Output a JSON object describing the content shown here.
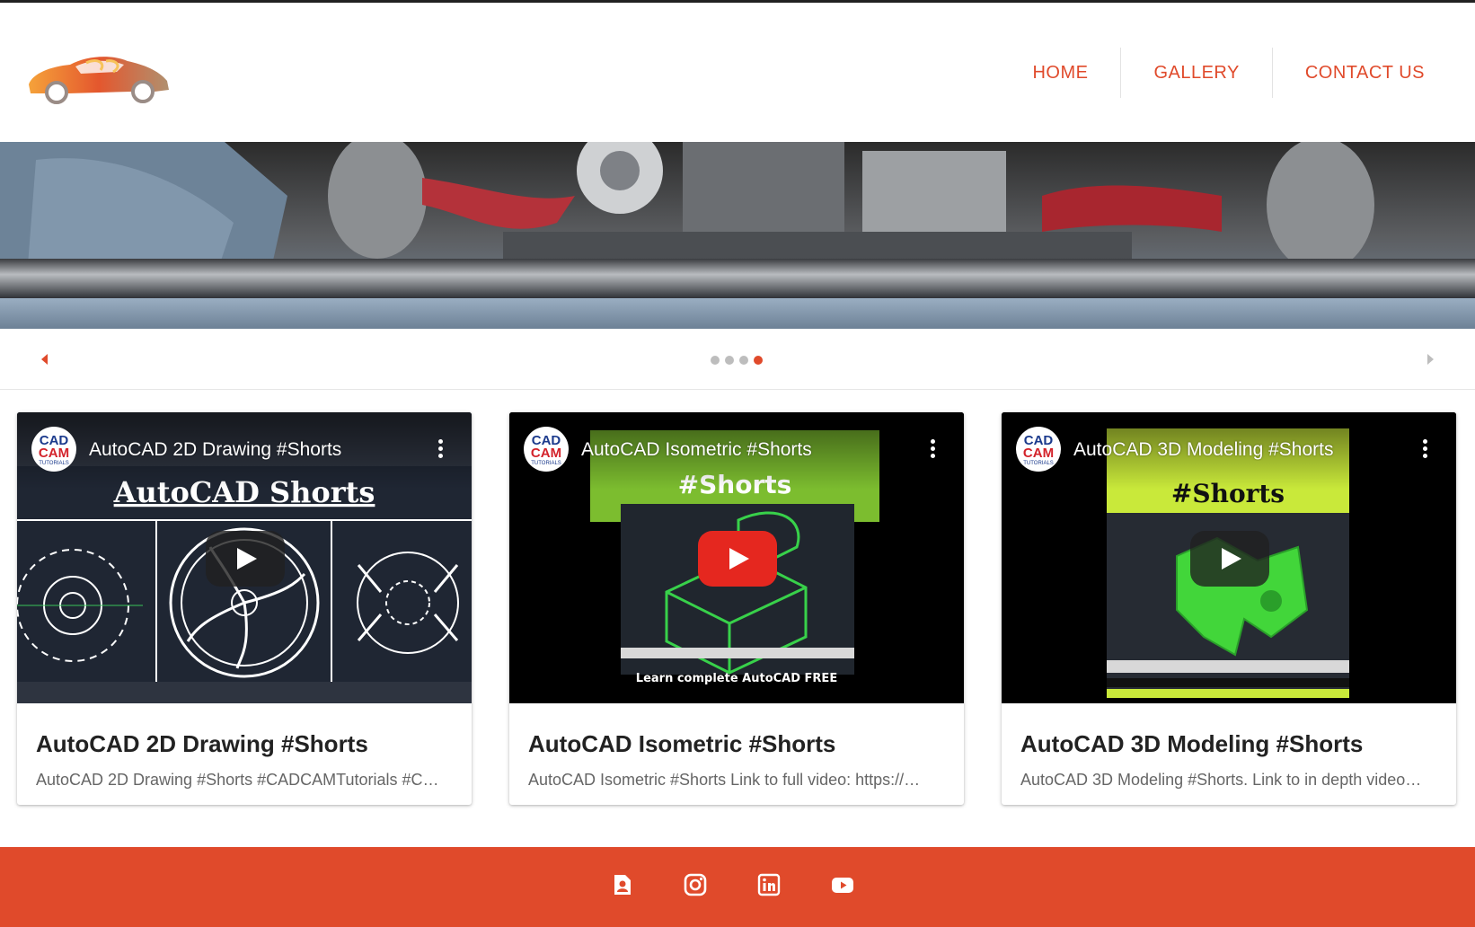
{
  "page": {
    "colors": {
      "accent": "#e04a2b",
      "footer": "#e04a2b",
      "dot_inactive": "#bdbdbd",
      "card_text": "#222222",
      "card_desc": "#666666"
    }
  },
  "header": {
    "logo": {
      "icon": "car-logo-icon"
    },
    "nav": [
      {
        "label": "HOME"
      },
      {
        "label": "GALLERY"
      },
      {
        "label": "CONTACT US"
      }
    ]
  },
  "carousel": {
    "prev_icon": "caret-left-icon",
    "next_icon": "caret-right-icon",
    "slide_count": 4,
    "active_index": 3
  },
  "videos": [
    {
      "embed_title": "AutoCAD 2D Drawing #Shorts",
      "thumbnail_text": "AutoCAD Shorts",
      "channel_avatar_text": [
        "CAD",
        "CAM",
        "TUTORIALS"
      ],
      "title": "AutoCAD 2D Drawing #Shorts",
      "description": "AutoCAD 2D Drawing #Shorts #CADCAMTutorials #C…"
    },
    {
      "embed_title": "AutoCAD Isometric #Shorts",
      "thumbnail_text": "#Shorts",
      "thumbnail_caption": "Learn complete AutoCAD FREE",
      "channel_avatar_text": [
        "CAD",
        "CAM",
        "TUTORIALS"
      ],
      "title": "AutoCAD Isometric #Shorts",
      "description": "AutoCAD Isometric #Shorts Link to full video: https://…"
    },
    {
      "embed_title": "AutoCAD 3D Modeling #Shorts",
      "thumbnail_text": "#Shorts",
      "channel_avatar_text": [
        "CAD",
        "CAM",
        "TUTORIALS"
      ],
      "title": "AutoCAD 3D Modeling #Shorts",
      "description": "AutoCAD 3D Modeling #Shorts. Link to in depth video…"
    }
  ],
  "footer": {
    "social": [
      {
        "icon": "contact-card-icon"
      },
      {
        "icon": "instagram-icon"
      },
      {
        "icon": "linkedin-icon"
      },
      {
        "icon": "youtube-icon"
      }
    ]
  }
}
